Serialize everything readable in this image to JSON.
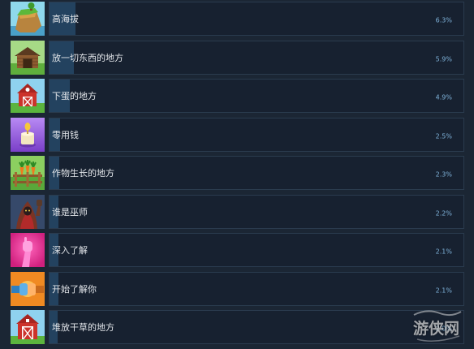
{
  "colors": {
    "page_bg": "#1b2634",
    "row_bg": "#172130",
    "row_border": "#2a3b4e",
    "fill": "#23425f",
    "label": "#e3e6ea",
    "percent": "#7fb3da"
  },
  "achievements": [
    {
      "name": "高海拔",
      "percent": "6.3%",
      "icon": "mountain-cliff-icon"
    },
    {
      "name": "放一切东西的地方",
      "percent": "5.9%",
      "icon": "storage-shed-icon"
    },
    {
      "name": "下蛋的地方",
      "percent": "4.9%",
      "icon": "chicken-coop-barn-icon"
    },
    {
      "name": "零用钱",
      "percent": "2.5%",
      "icon": "lamp-icon"
    },
    {
      "name": "作物生长的地方",
      "percent": "2.3%",
      "icon": "carrot-fence-icon"
    },
    {
      "name": "谁是巫师",
      "percent": "2.2%",
      "icon": "hooded-wizard-icon"
    },
    {
      "name": "深入了解",
      "percent": "2.1%",
      "icon": "raised-arm-icon"
    },
    {
      "name": "开始了解你",
      "percent": "2.1%",
      "icon": "fist-bump-icon"
    },
    {
      "name": "堆放干草的地方",
      "percent": "2.0%",
      "icon": "hay-barn-icon"
    }
  ],
  "watermark": {
    "text": "游侠网"
  }
}
